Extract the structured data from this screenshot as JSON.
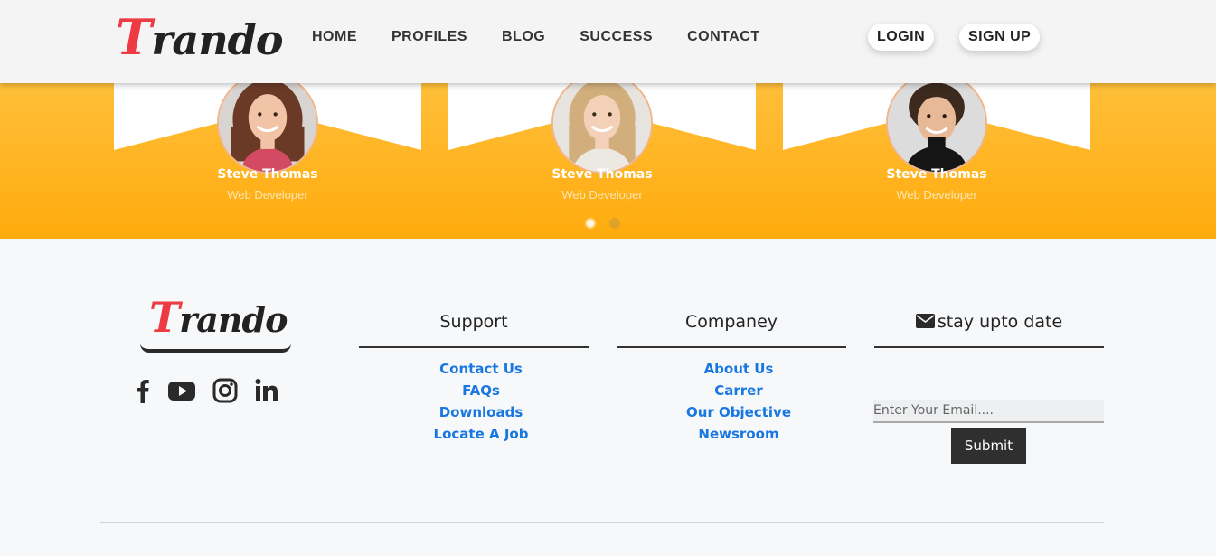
{
  "header": {
    "logo_first": "T",
    "logo_rest": "rando",
    "nav": [
      "HOME",
      "PROFILES",
      "BLOG",
      "SUCCESS",
      "CONTACT"
    ],
    "login": "LOGIN",
    "signup": "SIGN UP"
  },
  "team": {
    "members": [
      {
        "name": "Steve Thomas",
        "role": "Web Developer",
        "avatar": "woman-avatar"
      },
      {
        "name": "Steve Thomas",
        "role": "Web Developer",
        "avatar": "woman-avatar"
      },
      {
        "name": "Steve Thomas",
        "role": "Web Developer",
        "avatar": "man-avatar"
      }
    ],
    "slides": 2,
    "active_slide": 1
  },
  "footer": {
    "logo_first": "T",
    "logo_rest": "rando",
    "social": [
      "facebook-icon",
      "youtube-icon",
      "instagram-icon",
      "linkedin-icon"
    ],
    "support": {
      "title": "Support",
      "links": [
        "Contact Us",
        "FAQs",
        "Downloads",
        "Locate A Job"
      ]
    },
    "company": {
      "title": "Companey",
      "links": [
        "About Us",
        "Carrer",
        "Our Objective",
        "Newsroom"
      ]
    },
    "newsletter": {
      "title": "stay upto date",
      "icon": "envelope-icon",
      "placeholder": "Enter Your Email....",
      "submit": "Submit"
    }
  },
  "colors": {
    "accent": "#ffab0d",
    "logo_red": "#ee3a43",
    "link": "#1877e0"
  }
}
